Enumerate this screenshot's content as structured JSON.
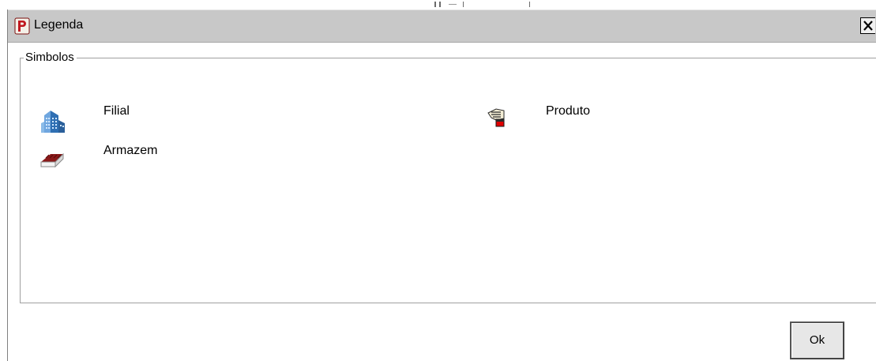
{
  "window": {
    "title": "Legenda",
    "close_label": "×"
  },
  "group": {
    "title": "Simbolos"
  },
  "legend_items": [
    {
      "icon": "building-icon",
      "label": "Filial"
    },
    {
      "icon": "product-icon",
      "label": "Produto"
    },
    {
      "icon": "warehouse-icon",
      "label": "Armazem"
    }
  ],
  "buttons": {
    "ok_label": "Ok"
  },
  "colors": {
    "titlebar": "#c8c8c8",
    "app_icon_red": "#c0181f",
    "building_blue": "#2f6fb3",
    "warehouse_red": "#8b1a1a",
    "product_red": "#e00000"
  }
}
